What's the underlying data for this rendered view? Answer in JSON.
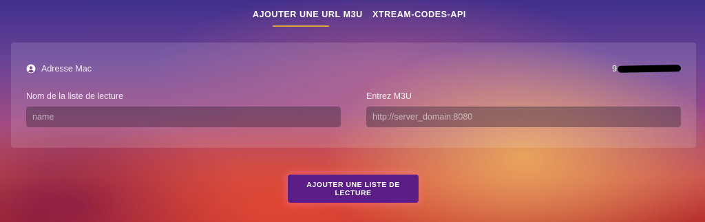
{
  "tabs": [
    {
      "label": "AJOUTER UNE URL M3U",
      "active": true
    },
    {
      "label": "XTREAM-CODES-API",
      "active": false
    }
  ],
  "accent_color": "#e0a83c",
  "mac": {
    "icon": "account-circle-icon",
    "label": "Adresse Mac",
    "value_visible": "9"
  },
  "form": {
    "playlist_name": {
      "label": "Nom de la liste de lecture",
      "placeholder": "name",
      "value": ""
    },
    "m3u_url": {
      "label": "Entrez M3U",
      "placeholder": "http://server_domain:8080",
      "value": ""
    }
  },
  "submit": {
    "label": "AJOUTER UNE LISTE DE LECTURE",
    "color": "#5a1e86"
  }
}
